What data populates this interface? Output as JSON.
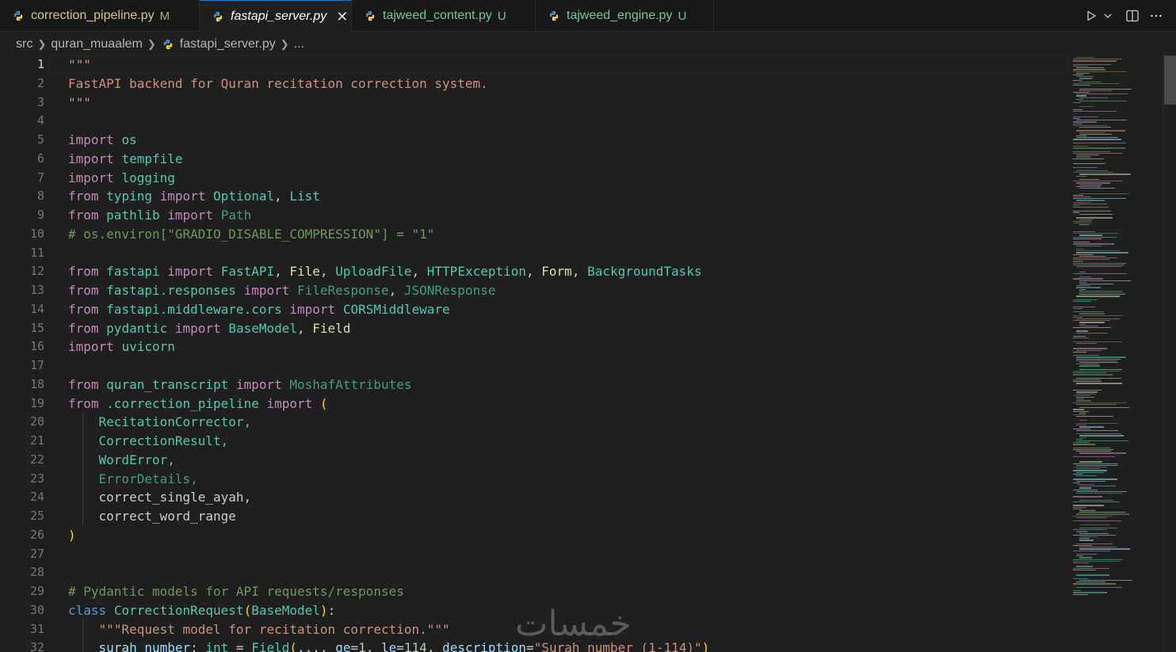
{
  "tabs": [
    {
      "label": "correction_pipeline.py",
      "status": "M"
    },
    {
      "label": "fastapi_server.py",
      "status": ""
    },
    {
      "label": "tajweed_content.py",
      "status": "U"
    },
    {
      "label": "tajweed_engine.py",
      "status": "U"
    }
  ],
  "actions": {
    "run": "run-icon",
    "split": "split-editor-icon",
    "more": "more-icon"
  },
  "breadcrumb": {
    "root": "src",
    "folder": "quran_muaalem",
    "file": "fastapi_server.py",
    "symbol": "..."
  },
  "editor": {
    "current_line": 1,
    "line_numbers": [
      "1",
      "2",
      "3",
      "4",
      "5",
      "6",
      "7",
      "8",
      "9",
      "10",
      "11",
      "12",
      "13",
      "14",
      "15",
      "16",
      "17",
      "18",
      "19",
      "20",
      "21",
      "22",
      "23",
      "24",
      "25",
      "26",
      "27",
      "28",
      "29",
      "30",
      "31",
      "32"
    ]
  },
  "code": {
    "l1": "\"\"\"",
    "l2": "FastAPI backend for Quran recitation correction system.",
    "l3": "\"\"\"",
    "l5_kw": "import",
    "l5_mod": "os",
    "l6_kw": "import",
    "l6_mod": "tempfile",
    "l7_kw": "import",
    "l7_mod": "logging",
    "l8_from": "from",
    "l8_mod": "typing",
    "l8_imp": "import",
    "l8_a": "Optional",
    "l8_b": "List",
    "l9_from": "from",
    "l9_mod": "pathlib",
    "l9_imp": "import",
    "l9_a": "Path",
    "l10": "# os.environ[\"GRADIO_DISABLE_COMPRESSION\"] = \"1\"",
    "l12_from": "from",
    "l12_mod": "fastapi",
    "l12_imp": "import",
    "l12_a": "FastAPI",
    "l12_b": "File",
    "l12_c": "UploadFile",
    "l12_d": "HTTPException",
    "l12_e": "Form",
    "l12_f": "BackgroundTasks",
    "l13_from": "from",
    "l13_mod": "fastapi.responses",
    "l13_imp": "import",
    "l13_a": "FileResponse",
    "l13_b": "JSONResponse",
    "l14_from": "from",
    "l14_mod": "fastapi.middleware.cors",
    "l14_imp": "import",
    "l14_a": "CORSMiddleware",
    "l15_from": "from",
    "l15_mod": "pydantic",
    "l15_imp": "import",
    "l15_a": "BaseModel",
    "l15_b": "Field",
    "l16_kw": "import",
    "l16_mod": "uvicorn",
    "l18_from": "from",
    "l18_mod": "quran_transcript",
    "l18_imp": "import",
    "l18_a": "MoshafAttributes",
    "l19_from": "from",
    "l19_mod": ".correction_pipeline",
    "l19_imp": "import",
    "l19_paren": "(",
    "l20": "RecitationCorrector,",
    "l21": "CorrectionResult,",
    "l22": "WordError,",
    "l23": "ErrorDetails,",
    "l24": "correct_single_ayah,",
    "l25": "correct_word_range",
    "l26": ")",
    "l29": "# Pydantic models for API requests/responses",
    "l30_kw": "class",
    "l30_name": "CorrectionRequest",
    "l30_base": "BaseModel",
    "l31": "\"\"\"Request model for recitation correction.\"\"\"",
    "l32_var": "surah_number",
    "l32_type": "int",
    "l32_fn": "Field",
    "l32_rest": "...,",
    "l32_ge": "ge",
    "l32_gev": "1",
    "l32_le": "le",
    "l32_lev": "114",
    "l32_desc": "description",
    "l32_str": "\"Surah number (1-114)\""
  },
  "watermark": "خمسات",
  "colors": {
    "accent": "#0078d4",
    "background": "#1f1f1f",
    "tabbar": "#181818"
  }
}
